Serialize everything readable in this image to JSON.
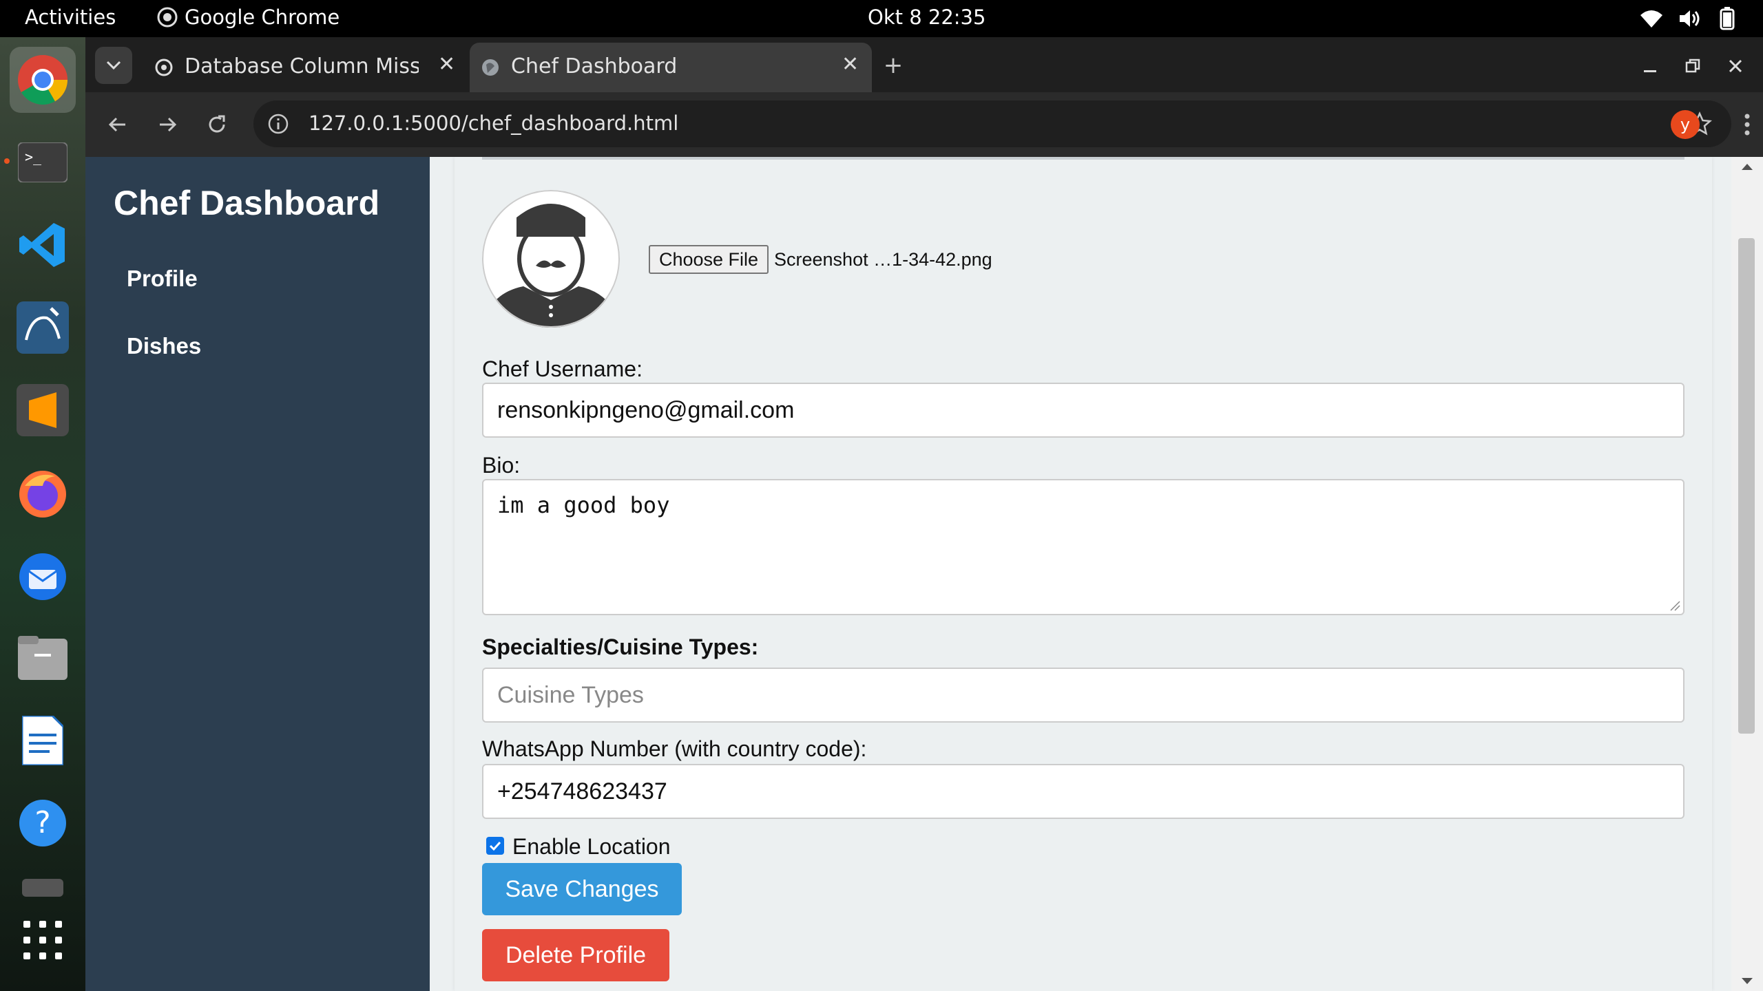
{
  "system_bar": {
    "activities": "Activities",
    "app_name": "Google Chrome",
    "clock": "Okt 8  22:35"
  },
  "dock": {
    "items": [
      "chrome-icon",
      "terminal-icon",
      "vscode-icon",
      "mysql-workbench-icon",
      "sublime-text-icon",
      "firefox-icon",
      "thunderbird-icon",
      "files-icon",
      "libreoffice-writer-icon",
      "help-icon",
      "app-grid-icon"
    ]
  },
  "browser": {
    "tabs": [
      {
        "title": "Database Column Missin",
        "active": false
      },
      {
        "title": "Chef Dashboard",
        "active": true
      }
    ],
    "url": "127.0.0.1:5000/chef_dashboard.html",
    "profile_initial": "y"
  },
  "sidebar": {
    "title": "Chef Dashboard",
    "items": [
      {
        "label": "Profile"
      },
      {
        "label": "Dishes"
      }
    ]
  },
  "profile_form": {
    "file_button": "Choose File",
    "file_name": "Screenshot …1-34-42.png",
    "username_label": "Chef Username:",
    "username_value": "rensonkipngeno@gmail.com",
    "bio_label": "Bio:",
    "bio_value": "im a good boy",
    "specialties_label": "Specialties/Cuisine Types:",
    "specialties_placeholder": "Cuisine Types",
    "whatsapp_label": "WhatsApp Number (with country code):",
    "whatsapp_value": "+254748623437",
    "location_label": "Enable Location",
    "location_checked": true,
    "save_button": "Save Changes",
    "delete_button": "Delete Profile"
  },
  "colors": {
    "sidebar_bg": "#2c3e50",
    "save_button": "#3498db",
    "delete_button": "#e74c3c",
    "page_bg": "#ecf0f1"
  }
}
